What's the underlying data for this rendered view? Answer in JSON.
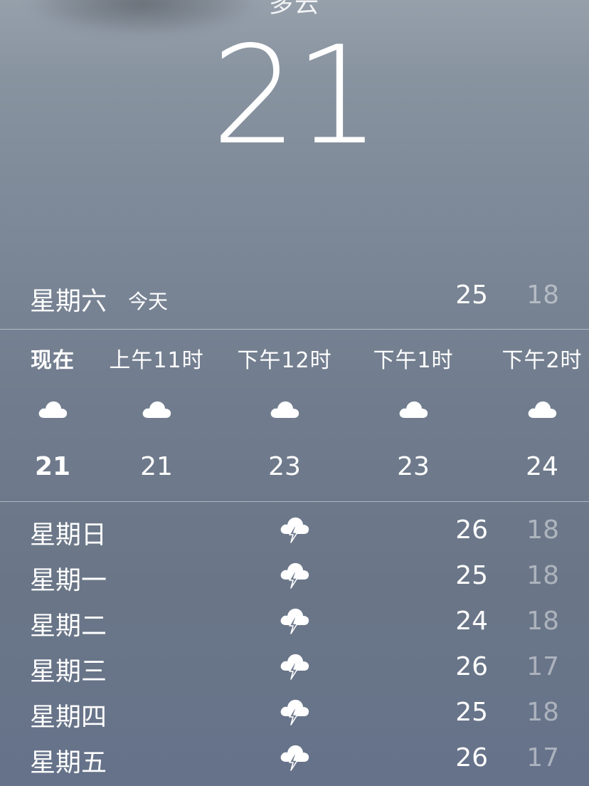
{
  "current": {
    "condition": "多云",
    "temperature": "21"
  },
  "today": {
    "day": "星期六",
    "tag": "今天",
    "high": "25",
    "low": "18"
  },
  "hourly": [
    {
      "time": "现在",
      "icon": "cloud-icon",
      "temp": "21"
    },
    {
      "time": "上午11时",
      "icon": "cloud-icon",
      "temp": "21"
    },
    {
      "time": "下午12时",
      "icon": "cloud-icon",
      "temp": "23"
    },
    {
      "time": "下午1时",
      "icon": "cloud-icon",
      "temp": "23"
    },
    {
      "time": "下午2时",
      "icon": "cloud-icon",
      "temp": "24"
    }
  ],
  "daily": [
    {
      "day": "星期日",
      "icon": "thunderstorm-icon",
      "high": "26",
      "low": "18"
    },
    {
      "day": "星期一",
      "icon": "thunderstorm-icon",
      "high": "25",
      "low": "18"
    },
    {
      "day": "星期二",
      "icon": "thunderstorm-icon",
      "high": "24",
      "low": "18"
    },
    {
      "day": "星期三",
      "icon": "thunderstorm-icon",
      "high": "26",
      "low": "17"
    },
    {
      "day": "星期四",
      "icon": "thunderstorm-icon",
      "high": "25",
      "low": "18"
    },
    {
      "day": "星期五",
      "icon": "thunderstorm-icon",
      "high": "26",
      "low": "17"
    }
  ]
}
